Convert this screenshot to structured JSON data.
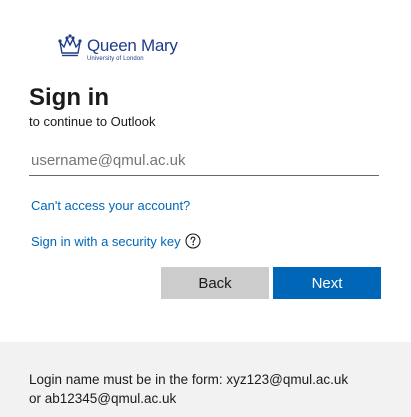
{
  "logo": {
    "name": "Queen Mary",
    "subtitle": "University of London"
  },
  "header": {
    "title": "Sign in",
    "subtitle": "to continue to Outlook"
  },
  "form": {
    "username_value": "",
    "username_placeholder": "username@qmul.ac.uk"
  },
  "links": {
    "cant_access": "Can't access your account?",
    "security_key": "Sign in with a security key"
  },
  "buttons": {
    "back": "Back",
    "next": "Next"
  },
  "footer": {
    "line1": "Login name must be in the form: xyz123@qmul.ac.uk",
    "line2": "or ab12345@qmul.ac.uk"
  },
  "colors": {
    "accent": "#0067b8",
    "brand": "#1f3c88",
    "back_button": "#cccccc",
    "footer_bg": "#f2f2f2"
  },
  "icons": [
    "queen-mary-crown-logo",
    "help-circle-icon"
  ]
}
